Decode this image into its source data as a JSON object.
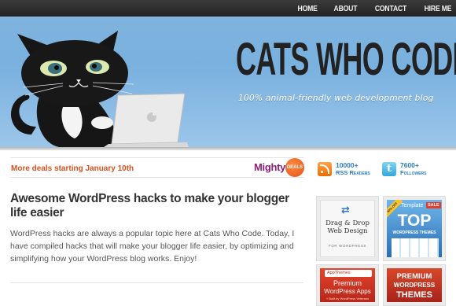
{
  "nav": {
    "items": [
      {
        "label": "HOME"
      },
      {
        "label": "ABOUT"
      },
      {
        "label": "CONTACT"
      },
      {
        "label": "HIRE ME"
      }
    ]
  },
  "header": {
    "title": "CATS WHO CODE",
    "tagline": "100% animal-friendly web development blog"
  },
  "deals": {
    "text": "More deals starting January 10th",
    "brand": "Mighty",
    "badge": "DEALS"
  },
  "post": {
    "title": "Awesome WordPress hacks to make your blogger life easier",
    "excerpt": "WordPress hacks are always a popular topic here at Cats Who Code. Today, I have compiled hacks that will make your blogger life easier, by optimizing and simplifying how your WordPress blog works. Enjoy!"
  },
  "sidebar": {
    "rss": {
      "count": "10000+",
      "label": "RSS Readers"
    },
    "twitter": {
      "count": "7600+",
      "label": "Followers"
    },
    "ads": [
      {
        "line1": "Drag & Drop",
        "line2": "Web Design",
        "line3": "FOR WORDPRESS"
      },
      {
        "line1": "Template",
        "badge": "SALE",
        "line2": "TOP",
        "line3": "WORDPRESS THEMES",
        "ribbon": "40% OFF"
      },
      {
        "line1": "AppThemes",
        "line2": "Premium",
        "line3": "WordPress Apps",
        "line4": "+ Built by WordPress Veterans"
      },
      {
        "line1": "PREMIUM",
        "line2": "WORDPRESS",
        "line3": "THEMES"
      }
    ]
  },
  "colors": {
    "accent_orange": "#d9501e",
    "link_blue": "#2a7cc4",
    "header_blue": "#7db3e0"
  }
}
